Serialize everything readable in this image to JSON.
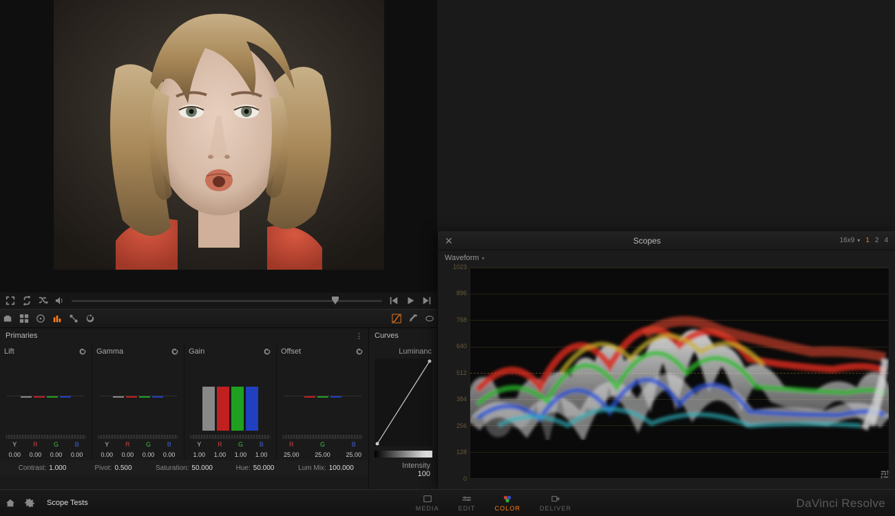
{
  "app_name": "DaVinci Resolve",
  "project_name": "Scope Tests",
  "nav": {
    "tabs": [
      {
        "id": "media",
        "label": "MEDIA"
      },
      {
        "id": "edit",
        "label": "EDIT"
      },
      {
        "id": "color",
        "label": "COLOR",
        "active": true
      },
      {
        "id": "deliver",
        "label": "DELIVER"
      }
    ]
  },
  "playback": {
    "icons": [
      "expand",
      "loop",
      "shuffle",
      "volume"
    ],
    "transport": [
      "prev",
      "play",
      "next"
    ]
  },
  "toolrow_left": [
    "camera",
    "grid",
    "target",
    "bars",
    "nodes",
    "refresh"
  ],
  "toolrow_right": [
    "curves",
    "picker",
    "mask"
  ],
  "toolrow_active": "bars",
  "primaries": {
    "title": "Primaries",
    "groups": [
      {
        "name": "Lift",
        "channels": [
          "Y",
          "R",
          "G",
          "B"
        ],
        "values": [
          "0.00",
          "0.00",
          "0.00",
          "0.00"
        ],
        "heights": [
          2,
          2,
          2,
          2
        ],
        "mode": "line"
      },
      {
        "name": "Gamma",
        "channels": [
          "Y",
          "R",
          "G",
          "B"
        ],
        "values": [
          "0.00",
          "0.00",
          "0.00",
          "0.00"
        ],
        "heights": [
          2,
          2,
          2,
          2
        ],
        "mode": "line"
      },
      {
        "name": "Gain",
        "channels": [
          "Y",
          "R",
          "G",
          "B"
        ],
        "values": [
          "1.00",
          "1.00",
          "1.00",
          "1.00"
        ],
        "heights": [
          64,
          64,
          64,
          64
        ],
        "mode": "bar"
      },
      {
        "name": "Offset",
        "channels": [
          "R",
          "G",
          "B"
        ],
        "values": [
          "25.00",
          "25.00",
          "25.00"
        ],
        "heights": [
          2,
          2,
          2
        ],
        "mode": "line"
      }
    ],
    "globals": [
      {
        "label": "Contrast:",
        "value": "1.000"
      },
      {
        "label": "Pivot:",
        "value": "0.500"
      },
      {
        "label": "Saturation:",
        "value": "50.000"
      },
      {
        "label": "Hue:",
        "value": "50.000"
      },
      {
        "label": "Lum Mix:",
        "value": "100.000"
      }
    ]
  },
  "curves": {
    "title": "Curves",
    "channel": "Luminanc",
    "intensity_label": "Intensity",
    "intensity_value": "100"
  },
  "scopes": {
    "title": "Scopes",
    "close": "✕",
    "aspect": "16x9",
    "layouts": [
      "1",
      "2",
      "4"
    ],
    "layout_active": "1",
    "type": "Waveform",
    "axis_max": 1023,
    "axis_ticks": [
      1023,
      896,
      768,
      640,
      512,
      384,
      256,
      128,
      0
    ]
  }
}
